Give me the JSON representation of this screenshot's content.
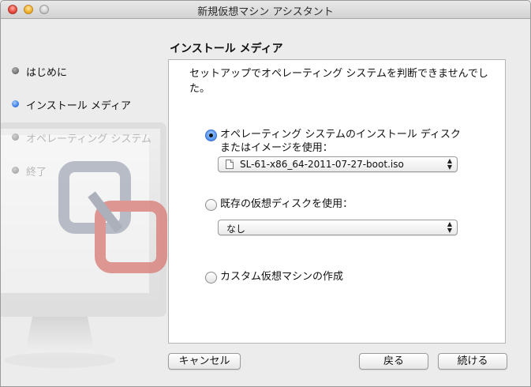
{
  "window": {
    "title": "新規仮想マシン アシスタント"
  },
  "colors": {
    "accent": "#3e80e6",
    "window_bg": "#ececec",
    "panel_bg": "#ffffff"
  },
  "steps": [
    {
      "label": "はじめに",
      "state": "done"
    },
    {
      "label": "インストール メディア",
      "state": "current"
    },
    {
      "label": "オペレーティング システム",
      "state": "pending"
    },
    {
      "label": "終了",
      "state": "pending"
    }
  ],
  "section": {
    "title": "インストール メディア"
  },
  "panel": {
    "description": "セットアップでオペレーティング システムを判断できませんでした。",
    "options": {
      "install_disc": {
        "label_line1": "オペレーティング システムのインストール ディスク",
        "label_line2": "またはイメージを使用：",
        "selected": true,
        "popup_value": "SL-61-x86_64-2011-07-27-boot.iso",
        "popup_icon": "document-icon"
      },
      "existing_disk": {
        "label": "既存の仮想ディスクを使用：",
        "selected": false,
        "popup_value": "なし"
      },
      "custom": {
        "label": "カスタム仮想マシンの作成",
        "selected": false
      }
    }
  },
  "buttons": {
    "cancel": "キャンセル",
    "back": "戻る",
    "continue": "続ける"
  }
}
